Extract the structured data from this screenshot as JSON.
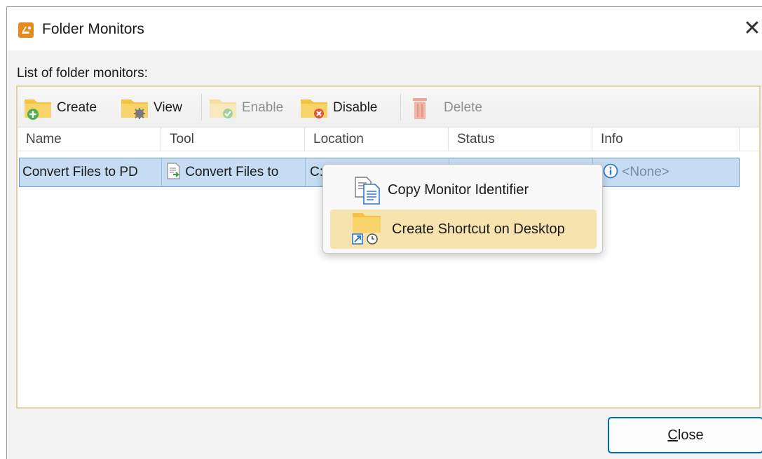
{
  "window": {
    "title": "Folder Monitors",
    "close_glyph": "✕"
  },
  "list_label": "List of folder monitors:",
  "toolbar": {
    "buttons": [
      {
        "label": "Create",
        "icon": "folder-add-icon",
        "enabled": true
      },
      {
        "label": "View",
        "icon": "folder-gear-icon",
        "enabled": true
      },
      {
        "label": "Enable",
        "icon": "folder-check-icon",
        "enabled": false
      },
      {
        "label": "Disable",
        "icon": "folder-remove-icon",
        "enabled": true
      },
      {
        "label": "Delete",
        "icon": "trash-icon",
        "enabled": false
      }
    ]
  },
  "table": {
    "columns": [
      "Name",
      "Tool",
      "Location",
      "Status",
      "Info"
    ],
    "rows": [
      {
        "name": "Convert Files to PD",
        "tool": "Convert Files to",
        "location": "C:",
        "status": "",
        "info": "<None>"
      }
    ]
  },
  "context_menu": {
    "items": [
      {
        "label": "Copy Monitor Identifier",
        "icon": "copy-document-icon",
        "highlighted": false
      },
      {
        "label": "Create Shortcut on Desktop",
        "icon": "folder-shortcut-icon",
        "highlighted": true
      }
    ]
  },
  "footer": {
    "close_label_first": "C",
    "close_label_rest": "lose"
  },
  "colors": {
    "folder": "#f5c342",
    "selection": "#c6dcf2",
    "menu_highlight": "#f6e3ad",
    "accent": "#0067c0"
  }
}
